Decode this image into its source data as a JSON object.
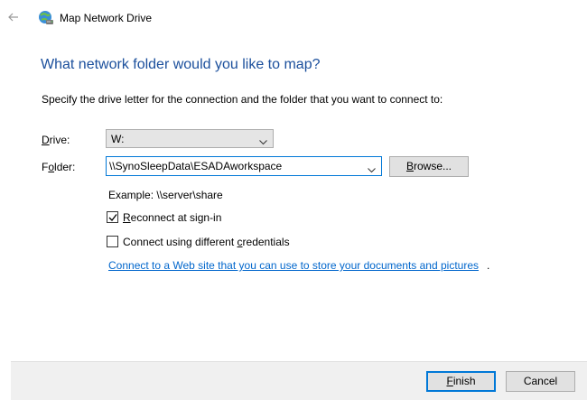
{
  "window": {
    "title": "Map Network Drive"
  },
  "wizard": {
    "heading": "What network folder would you like to map?",
    "instruction": "Specify the drive letter for the connection and the folder that you want to connect to:",
    "drive": {
      "label_accel": "D",
      "label_rest": "rive:",
      "selected": "W:"
    },
    "folder": {
      "label_pre": "F",
      "label_accel": "o",
      "label_rest": "lder:",
      "value": "\\\\SynoSleepData\\ESADAworkspace"
    },
    "browse": {
      "accel": "B",
      "rest": "rowse..."
    },
    "example": "Example: \\\\server\\share",
    "reconnect": {
      "accel": "R",
      "rest": "econnect at sign-in",
      "checked": true
    },
    "credentials": {
      "pre": "Connect using different ",
      "accel": "c",
      "rest": "redentials",
      "checked": false
    },
    "web_link": "Connect to a Web site that you can use to store your documents and pictures",
    "web_link_period": "."
  },
  "footer": {
    "finish": {
      "accel": "F",
      "rest": "inish"
    },
    "cancel": "Cancel"
  },
  "colors": {
    "heading": "#1b4f9c",
    "link": "#0066cc",
    "focus": "#0078d7",
    "footer_bg": "#f0f0f0"
  },
  "icons": {
    "back": "back-arrow-icon",
    "title": "network-drive-icon",
    "dropdown": "chevron-down-icon",
    "check": "checkmark-icon"
  }
}
